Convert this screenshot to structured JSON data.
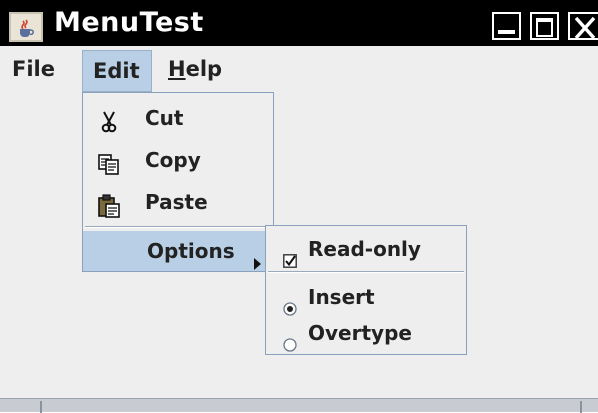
{
  "window": {
    "title": "MenuTest",
    "icon": "java-cup-icon"
  },
  "menubar": {
    "file_label": "File",
    "edit_label": "Edit",
    "help_prefix": "",
    "help_mnemonic": "H",
    "help_rest": "elp"
  },
  "edit_menu": {
    "items": [
      {
        "label": "Cut",
        "icon": "scissors-icon"
      },
      {
        "label": "Copy",
        "icon": "copy-icon"
      },
      {
        "label": "Paste",
        "icon": "paste-icon"
      }
    ],
    "options_label": "Options"
  },
  "options_menu": {
    "read_only": {
      "label": "Read-only",
      "checked": true
    },
    "insert": {
      "label": "Insert",
      "selected": true
    },
    "overtype": {
      "label": "Overtype",
      "selected": false
    }
  },
  "colors": {
    "title_bar": "#000000",
    "background": "#eeeeee",
    "selection": "#b8cfe5",
    "popup_border": "#8aa1bd",
    "text": "#222222"
  }
}
